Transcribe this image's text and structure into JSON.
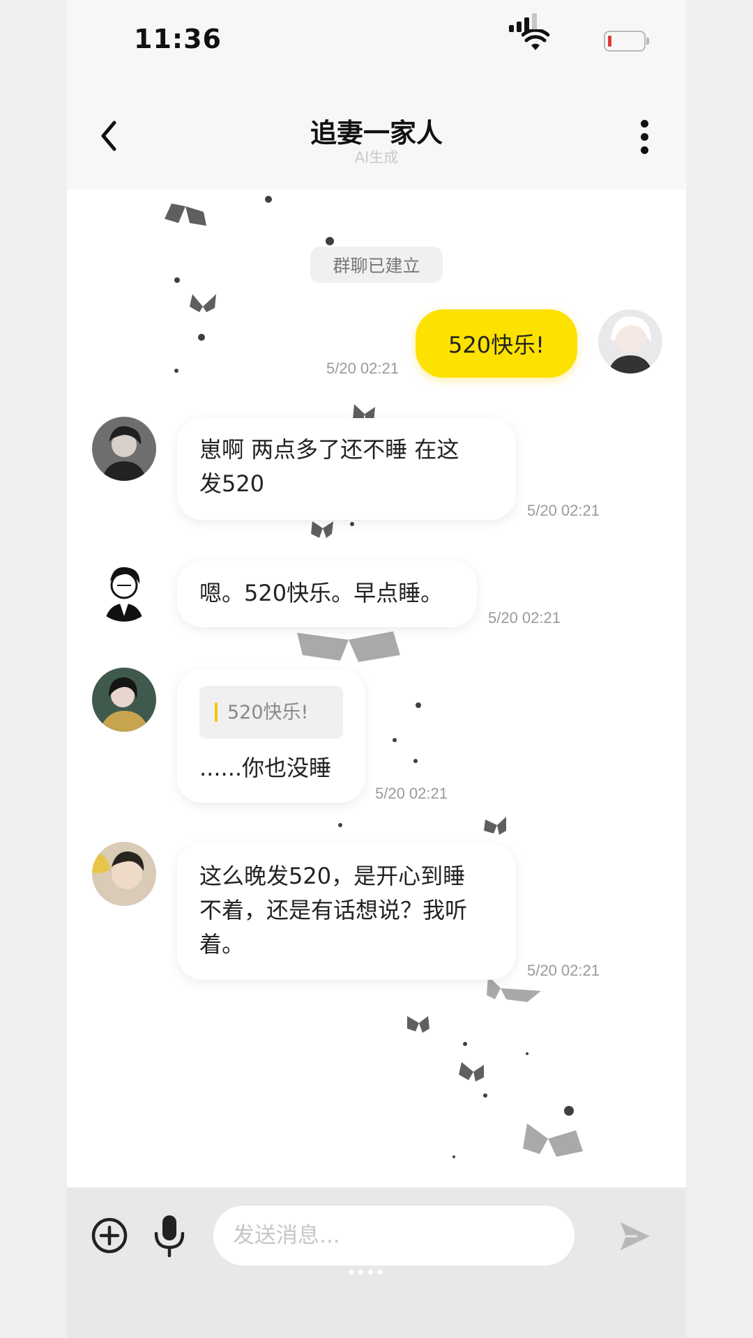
{
  "status_bar": {
    "time": "11:36"
  },
  "header": {
    "title": "追妻一家人",
    "subtitle": "AI生成"
  },
  "chat": {
    "system_notice": "群聊已建立",
    "messages": [
      {
        "sender": "self",
        "text": "520快乐!",
        "time": "5/20 02:21"
      },
      {
        "sender": "member",
        "text_lines": [
          "崽啊 两点多了还不睡 在这",
          "发520"
        ],
        "time": "5/20 02:21"
      },
      {
        "sender": "member",
        "text": "嗯。520快乐。早点睡。",
        "time": "5/20 02:21"
      },
      {
        "sender": "member",
        "quote": "520快乐!",
        "text": "......你也没睡",
        "time": "5/20 02:21"
      },
      {
        "sender": "member",
        "text_lines": [
          "这么晚发520，是开心到睡",
          "不着，还是有话想说？我听",
          "着。"
        ],
        "time": "5/20 02:21"
      }
    ]
  },
  "input_bar": {
    "placeholder": "发送消息..."
  },
  "colors": {
    "self_bubble": "#fde100",
    "accent": "#fde100"
  },
  "icons": [
    "back-icon",
    "more-icon",
    "add-icon",
    "mic-icon",
    "send-icon"
  ]
}
